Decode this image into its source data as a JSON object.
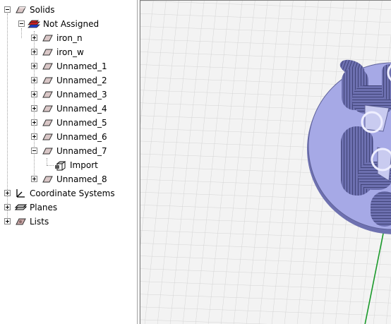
{
  "tree": {
    "root": {
      "label": "Solids",
      "icon": "solid-box-icon"
    },
    "group": {
      "label": "Not Assigned",
      "icon": "material-stack-icon"
    },
    "items": [
      {
        "label": "iron_n"
      },
      {
        "label": "iron_w"
      },
      {
        "label": "Unnamed_1"
      },
      {
        "label": "Unnamed_2"
      },
      {
        "label": "Unnamed_3"
      },
      {
        "label": "Unnamed_4"
      },
      {
        "label": "Unnamed_5"
      },
      {
        "label": "Unnamed_6"
      },
      {
        "label": "Unnamed_7"
      },
      {
        "label": "Unnamed_8"
      }
    ],
    "sub_item": {
      "label": "Import",
      "icon": "import-icon"
    },
    "coordinate_systems": {
      "label": "Coordinate Systems",
      "icon": "axes-icon"
    },
    "planes": {
      "label": "Planes",
      "icon": "planes-icon"
    },
    "lists": {
      "label": "Lists",
      "icon": "list-icon"
    }
  },
  "colors": {
    "grid": "#d4d4d4",
    "disc": "#a6a9e6",
    "disc_edge": "#5e6198",
    "coil": "#4f5188",
    "axis": "#1a9a2a"
  }
}
